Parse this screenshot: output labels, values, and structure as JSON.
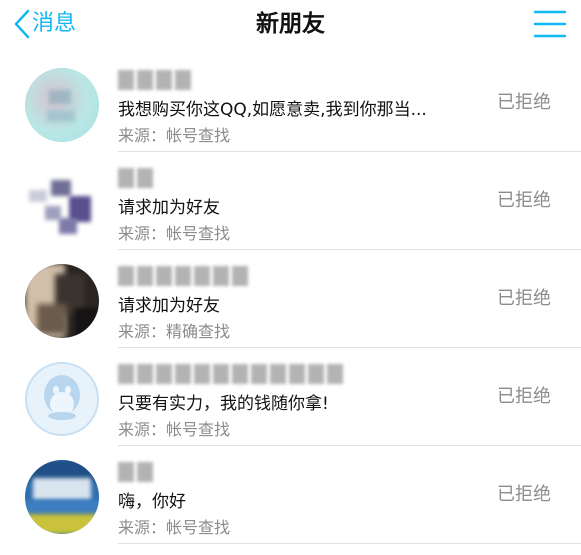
{
  "header": {
    "back_label": "消息",
    "title": "新朋友",
    "back_icon": "chevron-left-icon",
    "menu_icon": "hamburger-menu-icon",
    "accent_color": "#12b7f5"
  },
  "requests": [
    {
      "message": "我想购买你这QQ,如愿意卖,我到你那当...",
      "source": "来源：帐号查找",
      "status": "已拒绝"
    },
    {
      "message": "请求加为好友",
      "source": "来源：帐号查找",
      "status": "已拒绝"
    },
    {
      "message": "请求加为好友",
      "source": "来源：精确查找",
      "status": "已拒绝"
    },
    {
      "message": "只要有实力，我的钱随你拿!",
      "source": "来源：帐号查找",
      "status": "已拒绝"
    },
    {
      "message": "嗨，你好",
      "source": "来源：帐号查找",
      "status": "已拒绝"
    }
  ]
}
